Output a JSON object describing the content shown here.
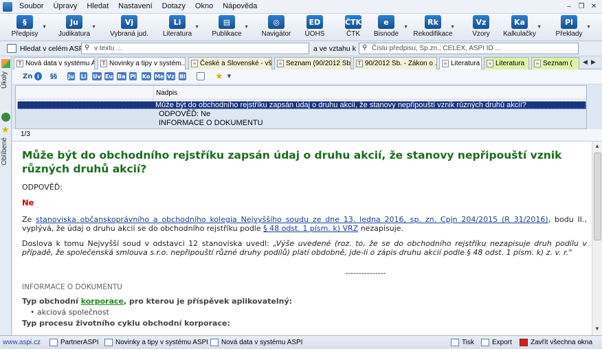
{
  "menu": [
    "Soubor",
    "Úpravy",
    "Hledat",
    "Nastavení",
    "Dotazy",
    "Okno",
    "Nápověda"
  ],
  "ribbon": [
    {
      "code": "§",
      "label": "Předpisy"
    },
    {
      "code": "Ju",
      "label": "Judikatura"
    },
    {
      "code": "Vj",
      "label": "Vybraná jud."
    },
    {
      "code": "Li",
      "label": "Literatura"
    },
    {
      "code": "▤",
      "label": "Publikace"
    },
    {
      "code": "◎",
      "label": "Navigátor"
    },
    {
      "code": "ED",
      "label": "ÚOHS"
    },
    {
      "code": "ČTK",
      "label": "ČTK"
    },
    {
      "code": "e",
      "label": "Bisnode"
    },
    {
      "code": "Rk",
      "label": "Rekodifikace"
    },
    {
      "code": "Vz",
      "label": "Vzory"
    },
    {
      "code": "Ka",
      "label": "Kalkulačky"
    },
    {
      "code": "Pl",
      "label": "Překlady"
    }
  ],
  "search": {
    "label": "Hledat v celém ASPI",
    "text_placeholder": "v textu ...",
    "relation_label": "a ve vztahu k",
    "number_placeholder": "Číslu předpisu, Sp.zn., CELEX, ASPI ID ..."
  },
  "leftbar": {
    "top_label": "Úkoly",
    "bottom_label": "Oblíbené"
  },
  "tabs": [
    "Nová data v systému A...",
    "Novinky a tipy v systém...",
    "České a Slovenské - vše...",
    "Seznam (90/2012 Sb.)",
    "90/2012 Sb. - Zákon o ...",
    "Literatura",
    "Literatura",
    "Seznam ("
  ],
  "doc_toolbar": [
    "Zn",
    "i",
    "§§",
    "Ju",
    "Li",
    "Uv",
    "Eu",
    "Ba",
    "Pl",
    "Ko",
    "Me",
    "Vz",
    "Bl"
  ],
  "results": {
    "column_header": "Nadpis",
    "selected": "Může být do obchodního rejstříku zapsán údaj o druhu akcií, že stanovy nepřipouští vznik různých druhů akcií?",
    "line1": "ODPOVĚĎ: Ne",
    "line2": "INFORMACE O DOKUMENTU",
    "counter": "1/3"
  },
  "document": {
    "title": "Může být do obchodního rejstříku zapsán údaj o druhu akcií, že stanovy nepřipouští vznik různých druhů akcií?",
    "answer_label": "ODPOVĚĎ:",
    "answer": "Ne",
    "p1_pre": "Ze ",
    "p1_link": "stanoviska občanskoprávního a obchodního kolegia Nejvyššího soudu ze dne 13. ledna 2016, sp. zn. Cpjn 204/2015 (R 31/2016)",
    "p1_mid": ", bodu II., vyplývá, že údaj o druhu akcií se do obchodního rejstříku podle ",
    "p1_link2": "§ 48 odst. 1 písm. k) VRZ",
    "p1_post": " nezapisuje.",
    "p2_pre": "Doslova k tomu Nejvyšší soud v odstavci 12 stanoviska uvedl: ",
    "p2_italic": "„Výše uvedené (roz. to, že se do obchodního rejstříku nezapisuje druh podílu v případě, že společenská smlouva s.r.o. nepřipouští různé druhy podílů) platí obdobně, jde-li o zápis druhu akcií podle § 48 odst. 1 písm. k) z. v. r.",
    "p2_post": "“",
    "divider": "---------------",
    "info_heading": "INFORMACE O DOKUMENTU",
    "info1_pre": "Typ obchodní ",
    "info1_link": "korporace",
    "info1_post": ", pro kterou je příspěvek aplikovatelný:",
    "info1_item": "akciová společnost",
    "info2": "Typ procesu životního cyklu obchodní korporace:"
  },
  "statusbar": {
    "url": "www.aspi.cz",
    "items": [
      "PartnerASPI",
      "Novinky a tipy v systému ASPI",
      "Nová data v systému ASPI"
    ],
    "right": [
      "Tisk",
      "Export",
      "Zavřít všechna okna"
    ]
  },
  "colors": {
    "title_green": "#1b6b1f",
    "answer_red": "#d40000",
    "link_blue": "#1a3a9a",
    "selection": "#1a3580"
  }
}
